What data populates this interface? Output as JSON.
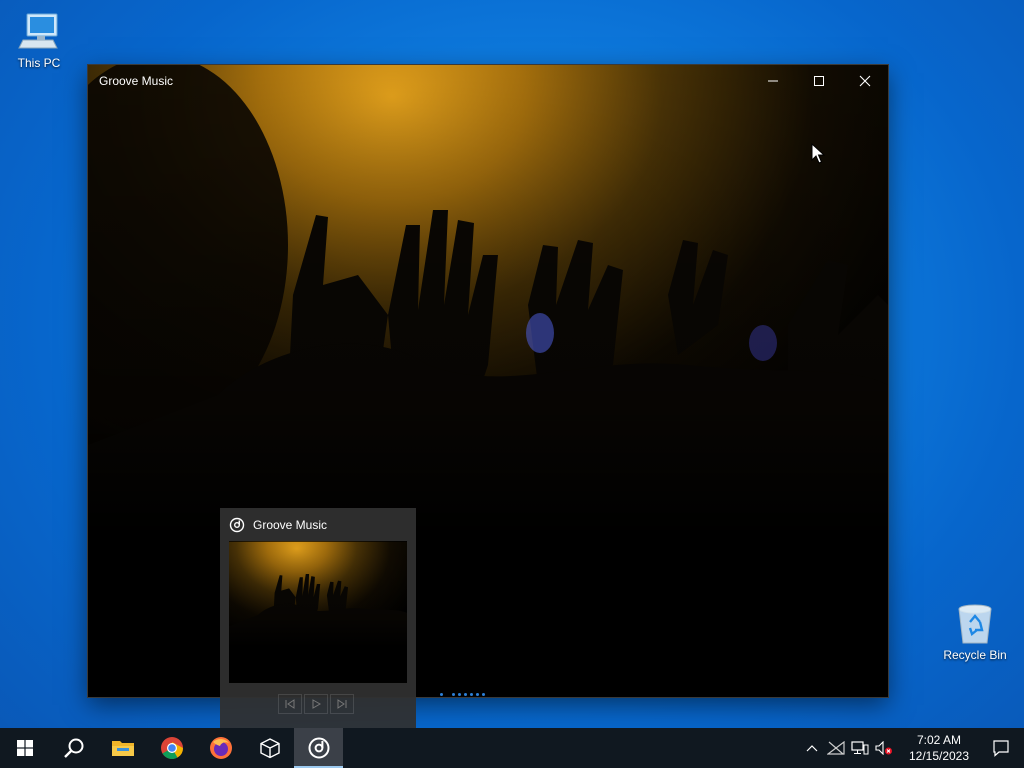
{
  "desktop": {
    "icons": [
      {
        "label": "This PC",
        "icon": "computer-icon"
      },
      {
        "label": "Recycle Bin",
        "icon": "recycle-bin-icon"
      }
    ]
  },
  "window": {
    "title": "Groove Music",
    "controls": {
      "minimize": "minimize-icon",
      "maximize": "maximize-icon",
      "close": "close-icon"
    },
    "loading_indicator": "loading-dots"
  },
  "thumbnail": {
    "title": "Groove Music",
    "controls": [
      "previous-icon",
      "play-icon",
      "next-icon"
    ]
  },
  "taskbar": {
    "items": [
      {
        "name": "start",
        "icon": "windows-logo-icon"
      },
      {
        "name": "search",
        "icon": "search-icon"
      },
      {
        "name": "file-explorer",
        "icon": "folder-icon"
      },
      {
        "name": "chrome",
        "icon": "chrome-icon"
      },
      {
        "name": "firefox",
        "icon": "firefox-icon"
      },
      {
        "name": "3d-viewer",
        "icon": "cube-icon"
      },
      {
        "name": "groove-music",
        "icon": "groove-music-icon"
      }
    ],
    "tray": {
      "icons": [
        "chevron-up-icon",
        "network-disconnected-icon",
        "display-icon",
        "volume-muted-icon"
      ],
      "time": "7:02 AM",
      "date": "12/15/2023",
      "notification_icon": "action-center-icon"
    }
  },
  "colors": {
    "desktop_blue": "#0f7ee0",
    "taskbar": "#101820",
    "accent": "#7fb7e6",
    "art_gold": "#e0a020"
  }
}
